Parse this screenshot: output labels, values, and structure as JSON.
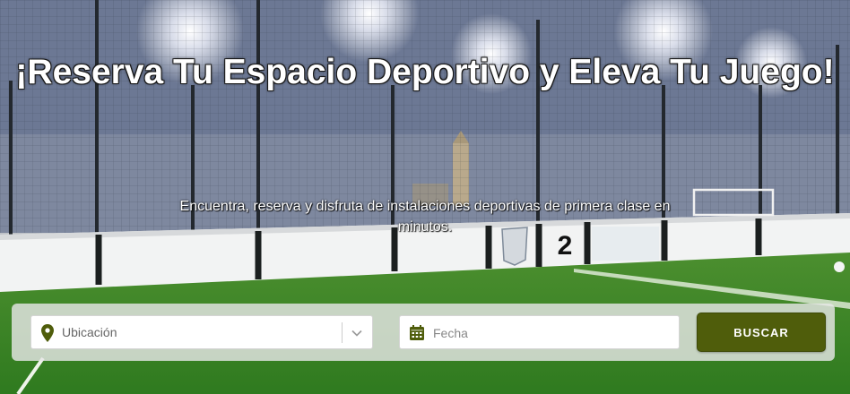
{
  "hero": {
    "title": "¡Reserva Tu Espacio Deportivo y Eleva Tu Juego!",
    "subtitle": "Encuentra, reserva y disfruta de instalaciones deportivas de primera clase en minutos.",
    "field_sign_number": "2"
  },
  "search": {
    "location_placeholder": "Ubicación",
    "date_placeholder": "Fecha",
    "button_label": "BUSCAR"
  },
  "colors": {
    "accent": "#4f5d0b",
    "icon": "#4f5d0b"
  },
  "icons": [
    "map-pin-icon",
    "chevron-down-icon",
    "calendar-icon"
  ]
}
